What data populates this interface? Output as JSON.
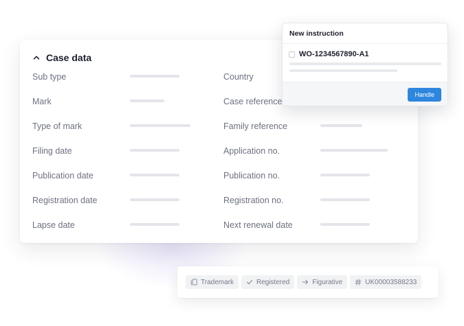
{
  "case_data": {
    "title": "Case data",
    "left_fields": [
      {
        "label": "Sub type"
      },
      {
        "label": "Mark"
      },
      {
        "label": "Type of mark"
      },
      {
        "label": "Filing date"
      },
      {
        "label": "Publication date"
      },
      {
        "label": "Registration date"
      },
      {
        "label": "Lapse date"
      }
    ],
    "right_fields": [
      {
        "label": "Country"
      },
      {
        "label": "Case reference"
      },
      {
        "label": "Family reference"
      },
      {
        "label": "Application no."
      },
      {
        "label": "Publication no."
      },
      {
        "label": "Registration no."
      },
      {
        "label": "Next renewal date"
      }
    ]
  },
  "instruction_popup": {
    "title": "New instruction",
    "reference": "WO-1234567890-A1",
    "handle_label": "Handle"
  },
  "tags": [
    {
      "icon": "copy-icon",
      "label": "Trademark"
    },
    {
      "icon": "check-icon",
      "label": "Registered"
    },
    {
      "icon": "arrow-right-icon",
      "label": "Figurative"
    },
    {
      "icon": "hash-icon",
      "label": "UK00003588233"
    }
  ],
  "colors": {
    "accent": "#2e86de",
    "placeholder": "#e3e5ea",
    "label_text": "#6d7180",
    "title_text": "#1b1e2b"
  }
}
